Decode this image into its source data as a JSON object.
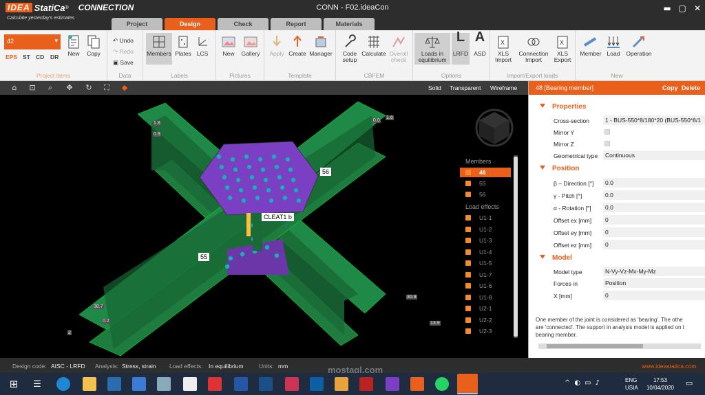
{
  "app": {
    "brand": "IDEA",
    "product": "StatiCa",
    "reg": "®",
    "module": "CONNECTION",
    "tagline": "Calculate yesterday's estimates",
    "window_title": "CONN - F02.ideaCon",
    "accent": "#e8601c"
  },
  "tabs": [
    "Project",
    "Design",
    "Check",
    "Report",
    "Materials"
  ],
  "active_tab": "Design",
  "ribbon": {
    "project_items": {
      "selected": "42",
      "kinds": [
        "EPS",
        "ST",
        "CD",
        "DR"
      ],
      "new": "New",
      "copy": "Copy",
      "label": "Project items"
    },
    "data": {
      "undo": "Undo",
      "redo": "Redo",
      "save": "Save",
      "label": "Data"
    },
    "labels": {
      "members": "Members",
      "plates": "Plates",
      "lcs": "LCS",
      "label": "Labels"
    },
    "pictures": {
      "new": "New",
      "gallery": "Gallery",
      "label": "Pictures"
    },
    "template": {
      "apply": "Apply",
      "create": "Create",
      "manager": "Manager",
      "label": "Template"
    },
    "cbfem": {
      "code_setup": "Code setup",
      "calculate": "Calculate",
      "overall_check": "Overall check",
      "label": "CBFEM"
    },
    "options": {
      "loads_eq": "Loads in equilibrium",
      "lrfd": "LRFD",
      "asd": "ASD",
      "label": "Options"
    },
    "import_export": {
      "xls_import": "XLS Import",
      "connection_import": "Connection Import",
      "xls_export": "XLS Export",
      "label": "Import/Export loads"
    },
    "new_group": {
      "member": "Member",
      "load": "Load",
      "operation": "Operation",
      "label": "New"
    }
  },
  "viewport": {
    "modes": [
      "Solid",
      "Transparent",
      "Wireframe"
    ],
    "labels": {
      "m56": "56",
      "m55": "55",
      "cleat": "CLEAT1 b"
    },
    "dims": [
      "1.8",
      "0.8",
      "0.0",
      "1.6",
      "38.7",
      "0.2",
      "2",
      "30.9",
      "13.9"
    ]
  },
  "member_list": {
    "members_header": "Members",
    "members": [
      "48",
      "55",
      "56"
    ],
    "selected_member": "48",
    "load_header": "Load effects",
    "loads": [
      "U1-1",
      "U1-2",
      "U1-3",
      "U1-4",
      "U1-5",
      "U1-7",
      "U1-6",
      "U1-8",
      "U2-1",
      "U2-2",
      "U2-3"
    ]
  },
  "panel": {
    "title": "48  [Bearing member]",
    "copy": "Copy",
    "delete": "Delete",
    "properties_header": "Properties",
    "cross_section_label": "Cross-section",
    "cross_section": "1 - BUS-550*8/180*20 (BUS-550*8/1",
    "mirror_y": "Mirror Y",
    "mirror_z": "Mirror Z",
    "geom_type_label": "Geometrical type",
    "geom_type": "Continuous",
    "position_header": "Position",
    "beta_label": "β – Direction [°]",
    "beta": "0.0",
    "gamma_label": "γ - Pitch [°]",
    "gamma": "0.0",
    "alpha_label": "α - Rotation [°]",
    "alpha": "0.0",
    "ex_label": "Offset ex [mm]",
    "ex": "0",
    "ey_label": "Offset ey [mm]",
    "ey": "0",
    "ez_label": "Offset ez [mm]",
    "ez": "0",
    "model_header": "Model",
    "model_type_label": "Model type",
    "model_type": "N-Vy-Vz-Mx-My-Mz",
    "forces_in_label": "Forces in",
    "forces_in": "Position",
    "x_label": "X [mm]",
    "x": "0",
    "note1": "One member of the joint is considered as 'bearing'. The othe",
    "note2": "are 'connected'. The support in analysis model is applied on t",
    "note3": "bearing member."
  },
  "status": {
    "design_code_key": "Design code:",
    "design_code": "AISC - LRFD",
    "analysis_key": "Analysis:",
    "analysis": "Stress, strain",
    "load_effects_key": "Load effects:",
    "load_effects": "In equilibrium",
    "units_key": "Units:",
    "units": "mm",
    "website": "www.ideastatica.com"
  },
  "taskbar": {
    "lang": "ENG",
    "region": "USIA",
    "time": "17:53",
    "date": "10/04/2020"
  },
  "watermark": "mostaql.com"
}
